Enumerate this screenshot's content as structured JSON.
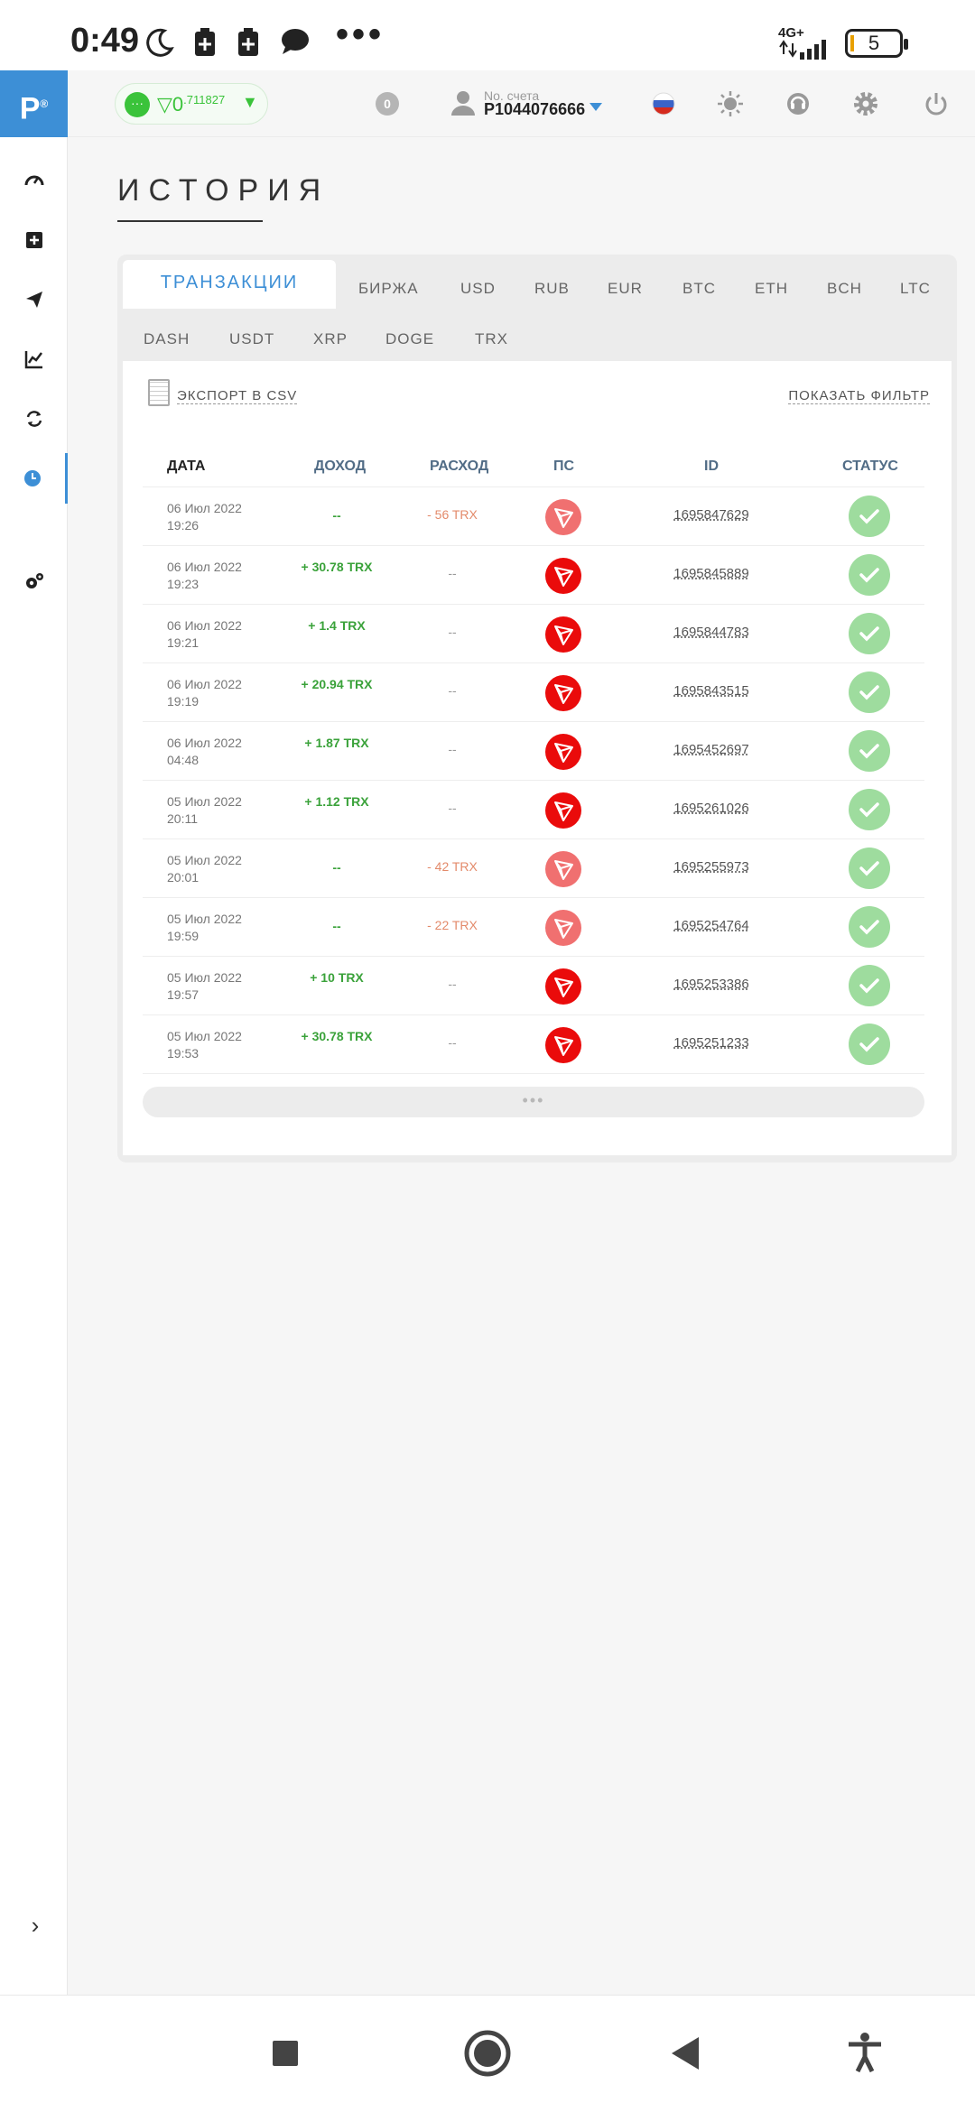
{
  "status_bar": {
    "time": "0:49",
    "network": "4G+",
    "battery": "5"
  },
  "sidebar": {
    "logo": "P"
  },
  "topbar": {
    "balance_main": "0",
    "balance_small": ".711827",
    "notification_count": "0",
    "account_label": "No. счета",
    "account_number": "P1044076666"
  },
  "page": {
    "title": "ИСТОРИЯ",
    "tabs_row1": [
      "ТРАНЗАКЦИИ",
      "БИРЖА",
      "USD",
      "RUB",
      "EUR",
      "BTC",
      "ETH",
      "BCH",
      "LTC"
    ],
    "tabs_row2": [
      "DASH",
      "USDT",
      "XRP",
      "DOGE",
      "TRX"
    ],
    "export_label": "ЭКСПОРТ В CSV",
    "filter_label": "ПОКАЗАТЬ ФИЛЬТР",
    "more_label": "•••"
  },
  "table": {
    "headers": [
      "ДАТА",
      "ДОХОД",
      "РАСХОД",
      "ПС",
      "ID",
      "СТАТУС"
    ],
    "rows": [
      {
        "date": "06 Июл 2022",
        "time": "19:26",
        "income": "--",
        "expense": "- 56 TRX",
        "id": "1695847629"
      },
      {
        "date": "06 Июл 2022",
        "time": "19:23",
        "income": "+ 30.78 TRX",
        "expense": "--",
        "id": "1695845889"
      },
      {
        "date": "06 Июл 2022",
        "time": "19:21",
        "income": "+ 1.4 TRX",
        "expense": "--",
        "id": "1695844783"
      },
      {
        "date": "06 Июл 2022",
        "time": "19:19",
        "income": "+ 20.94 TRX",
        "expense": "--",
        "id": "1695843515"
      },
      {
        "date": "06 Июл 2022",
        "time": "04:48",
        "income": "+ 1.87 TRX",
        "expense": "--",
        "id": "1695452697"
      },
      {
        "date": "05 Июл 2022",
        "time": "20:11",
        "income": "+ 1.12 TRX",
        "expense": "--",
        "id": "1695261026"
      },
      {
        "date": "05 Июл 2022",
        "time": "20:01",
        "income": "--",
        "expense": "- 42 TRX",
        "id": "1695255973"
      },
      {
        "date": "05 Июл 2022",
        "time": "19:59",
        "income": "--",
        "expense": "- 22 TRX",
        "id": "1695254764"
      },
      {
        "date": "05 Июл 2022",
        "time": "19:57",
        "income": "+ 10 TRX",
        "expense": "--",
        "id": "1695253386"
      },
      {
        "date": "05 Июл 2022",
        "time": "19:53",
        "income": "+ 30.78 TRX",
        "expense": "--",
        "id": "1695251233"
      }
    ]
  },
  "colors": {
    "accent": "#3d8fd6",
    "income": "#3aa23a",
    "expense": "#e38a6a",
    "tron": "#ea0b0b",
    "status_ok": "#9edc9e"
  }
}
